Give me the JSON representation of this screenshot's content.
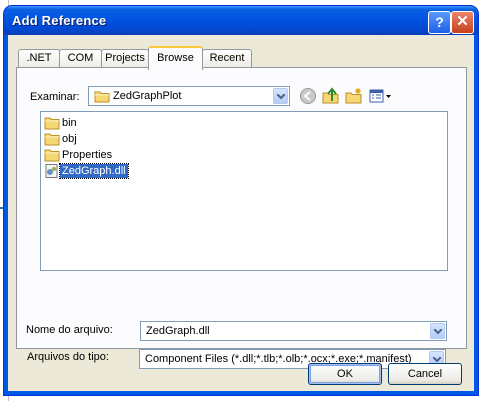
{
  "window": {
    "title": "Add Reference"
  },
  "titlebar": {
    "help_glyph": "?",
    "close_glyph": "✕"
  },
  "tabs": [
    {
      "label": ".NET",
      "active": false
    },
    {
      "label": "COM",
      "active": false
    },
    {
      "label": "Projects",
      "active": false
    },
    {
      "label": "Browse",
      "active": true
    },
    {
      "label": "Recent",
      "active": false
    }
  ],
  "browse": {
    "look_in_label": "Examinar:",
    "look_in_value": "ZedGraphPlot",
    "toolbar_icons": [
      "back-icon",
      "up-folder-icon",
      "new-folder-icon",
      "view-menu-icon"
    ]
  },
  "files": [
    {
      "name": "bin",
      "type": "folder",
      "selected": false
    },
    {
      "name": "obj",
      "type": "folder",
      "selected": false
    },
    {
      "name": "Properties",
      "type": "folder",
      "selected": false
    },
    {
      "name": "ZedGraph.dll",
      "type": "dll",
      "selected": true
    }
  ],
  "filename": {
    "label": "Nome do arquivo:",
    "value": "ZedGraph.dll"
  },
  "filetype": {
    "label": "Arquivos do tipo:",
    "value": "Component Files (*.dll;*.tlb;*.olb;*.ocx;*.exe;*.manifest)"
  },
  "buttons": {
    "ok": "OK",
    "cancel": "Cancel"
  },
  "colors": {
    "title_bar": "#0054e3",
    "selection": "#316ac5",
    "dialog_face": "#ece9d8",
    "active_tab_accent": "#ffc83c"
  }
}
